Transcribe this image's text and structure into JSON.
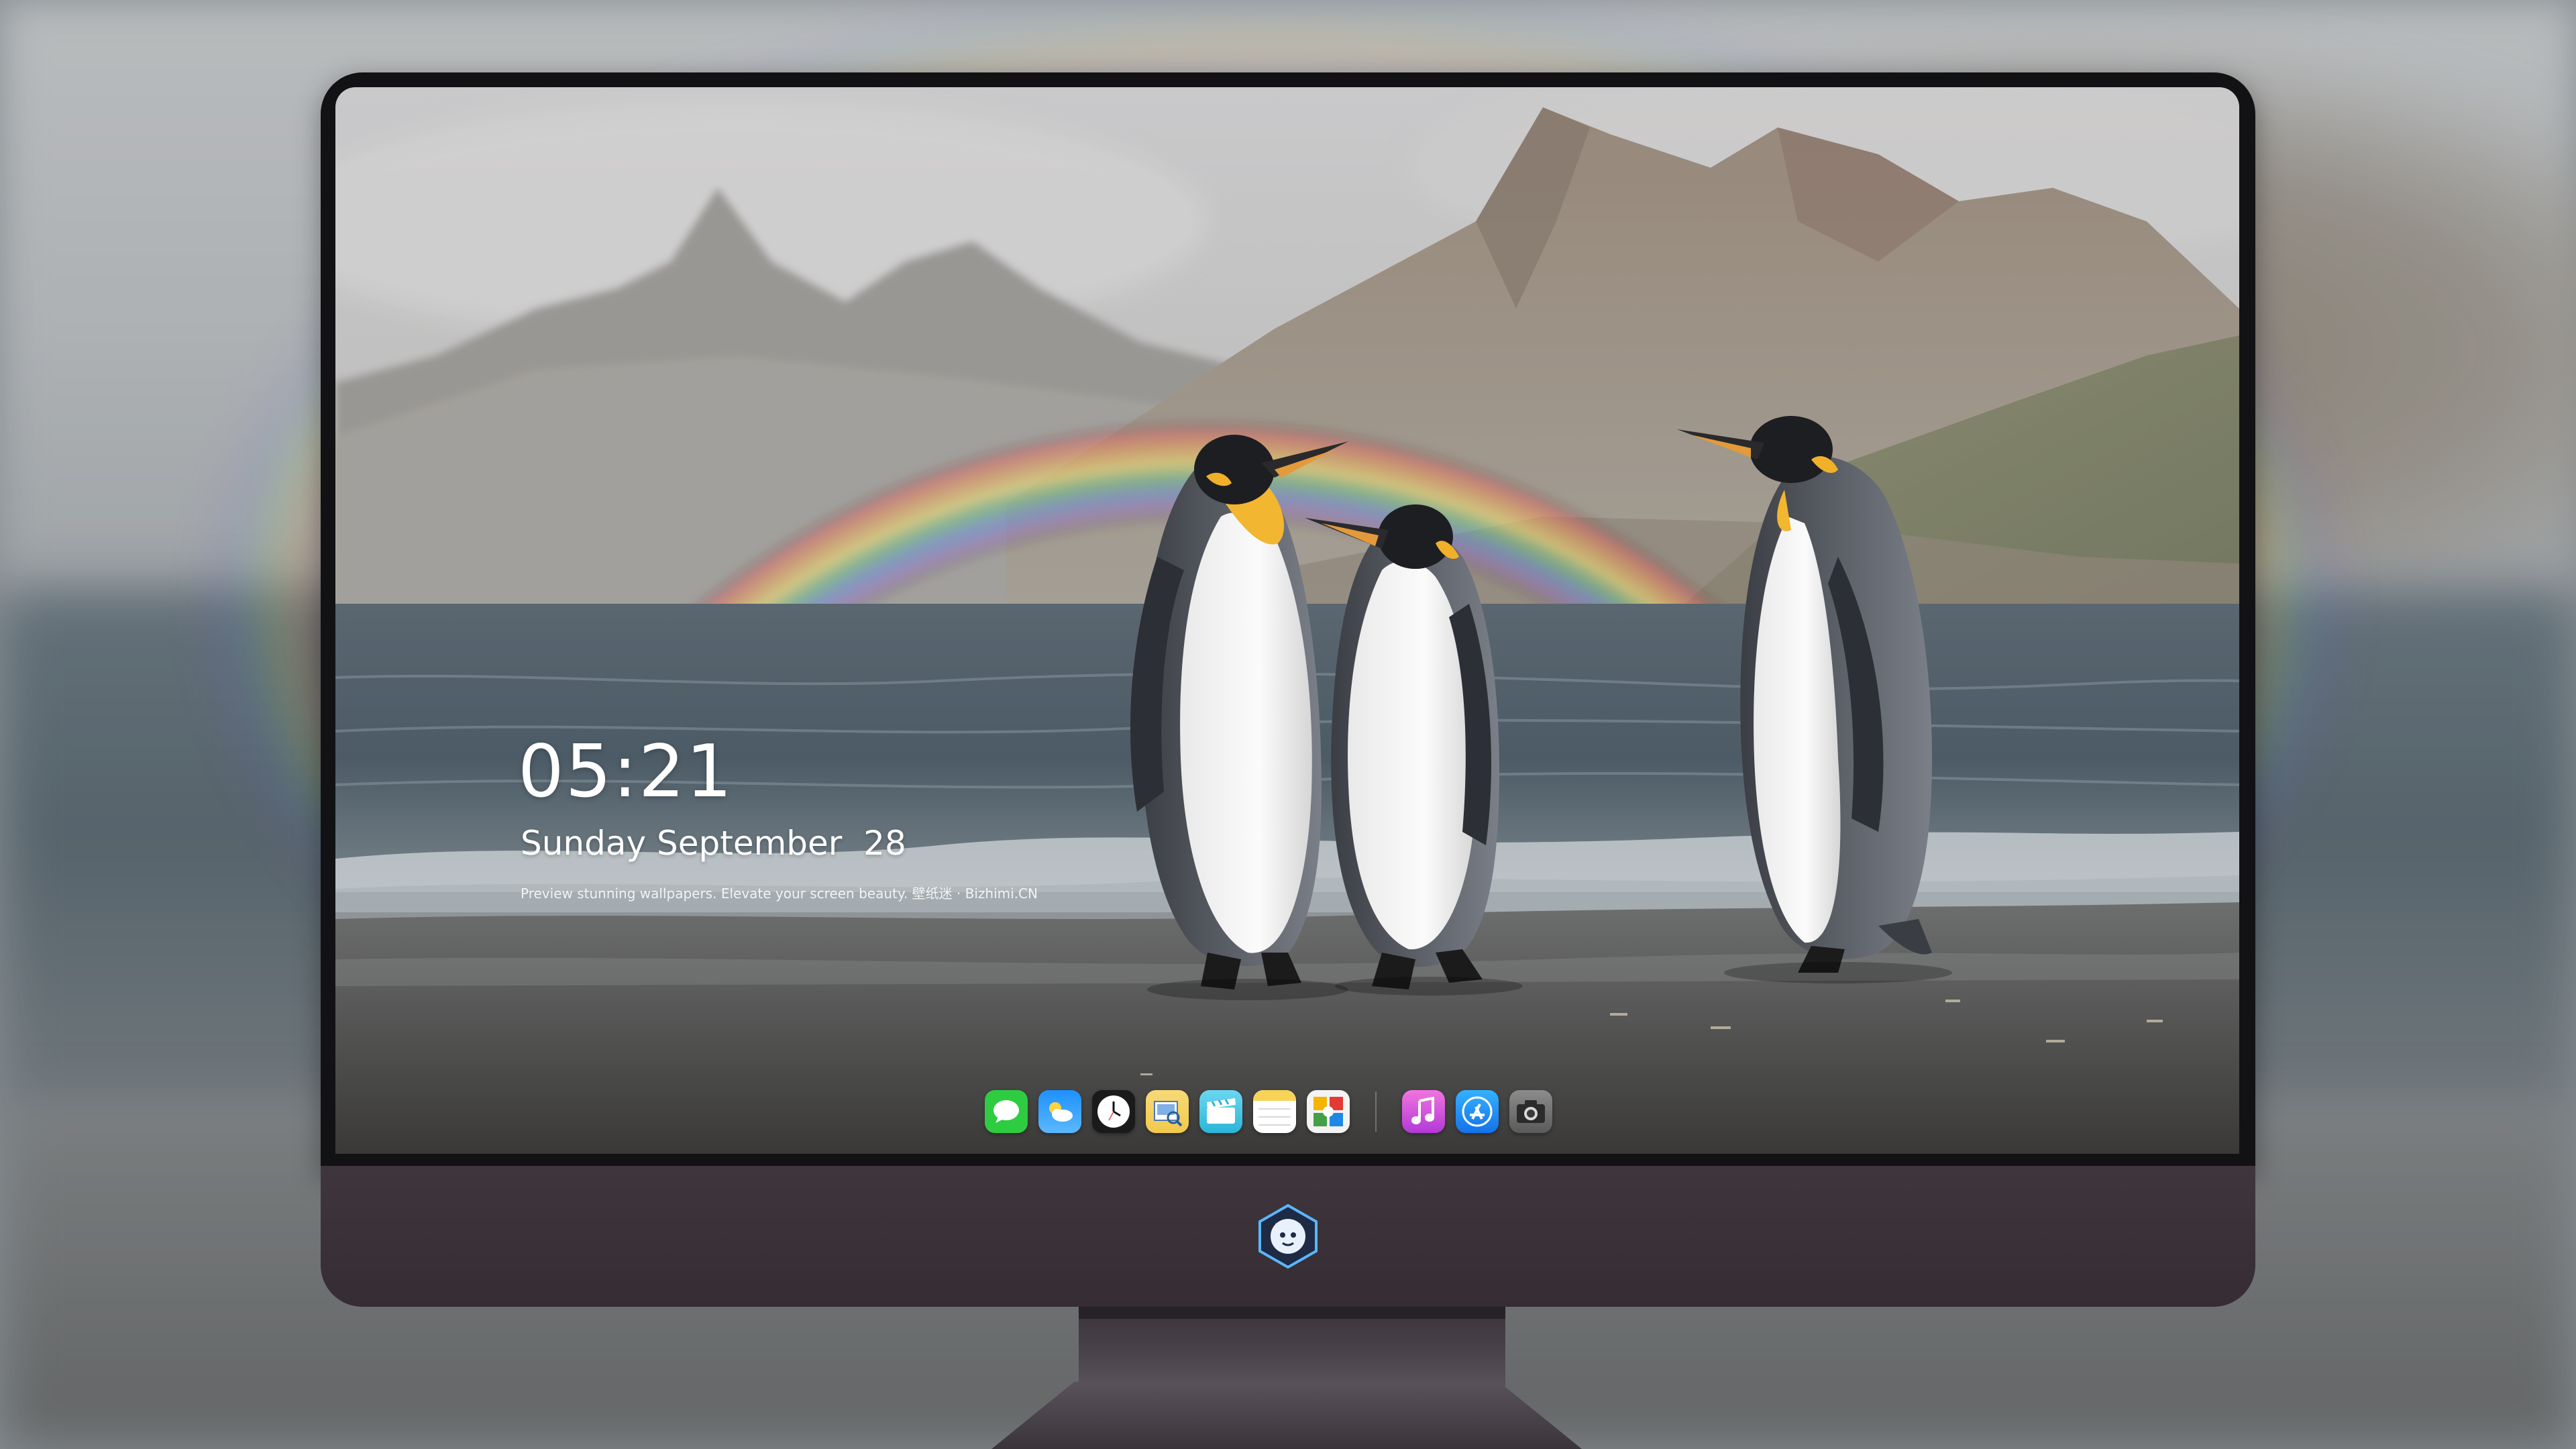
{
  "lockscreen": {
    "time": "05:21",
    "date": "Sunday September  28",
    "tagline": "Preview stunning wallpapers. Elevate your screen beauty. 壁纸迷 · Bizhimi.CN"
  },
  "dock": {
    "apps": [
      {
        "name": "Messages",
        "icon": "messages-icon",
        "color": "#2ecc40"
      },
      {
        "name": "Weather",
        "icon": "weather-icon",
        "color": "#1e90ff"
      },
      {
        "name": "Clock",
        "icon": "clock-icon",
        "color": "#1a1a1a"
      },
      {
        "name": "Preview",
        "icon": "preview-icon",
        "color": "#f2c94c"
      },
      {
        "name": "Clips",
        "icon": "clips-icon",
        "color": "#4ac9e8"
      },
      {
        "name": "Notes",
        "icon": "notes-icon",
        "color": "#f7d358"
      },
      {
        "name": "Photo Booth",
        "icon": "photo-booth-icon",
        "color": "#3a7bd5"
      },
      {
        "name": "iTunes",
        "icon": "itunes-icon",
        "color": "#d94fd9"
      },
      {
        "name": "App Store",
        "icon": "app-store-icon",
        "color": "#1e88f5"
      },
      {
        "name": "Screenshot",
        "icon": "camera-icon",
        "color": "#6b6b6b"
      }
    ]
  },
  "colors": {
    "bezel": "#121214",
    "chin": "#3b3239",
    "sea": "#4e5f6b",
    "sky": "#c9c6c1"
  }
}
